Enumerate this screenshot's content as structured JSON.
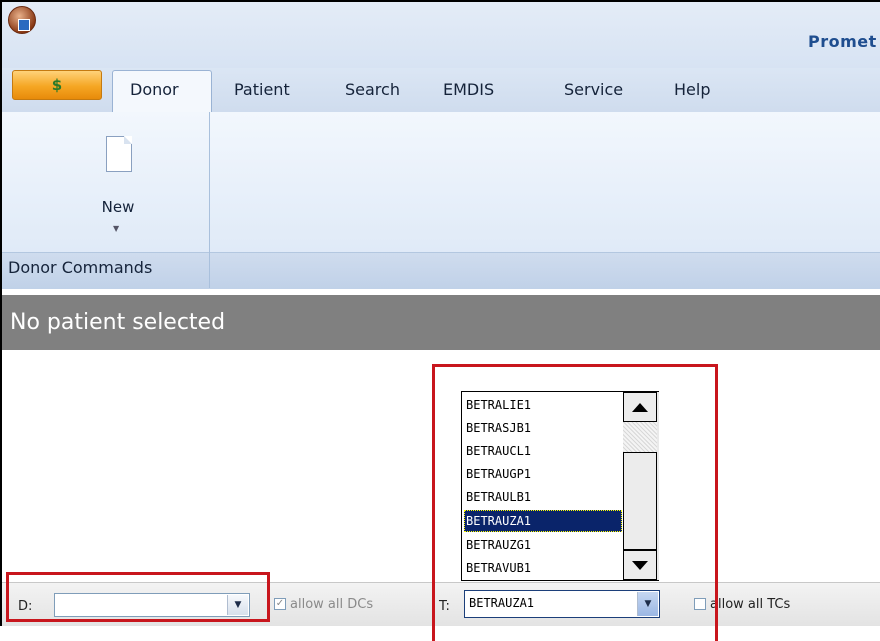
{
  "app": {
    "title": "Promet"
  },
  "tabs": [
    {
      "label": "Donor",
      "selected": true
    },
    {
      "label": "Patient"
    },
    {
      "label": "Search"
    },
    {
      "label": "EMDIS"
    },
    {
      "label": "Service"
    },
    {
      "label": "Help"
    }
  ],
  "home_button": {
    "icon": "dollar-icon",
    "glyph": "$"
  },
  "ribbon": {
    "new_label": "New",
    "new_icon": "new-document-icon",
    "group_label": "Donor Commands"
  },
  "status": {
    "text": "No patient selected"
  },
  "bottom": {
    "d_label": "D:",
    "d_value": "",
    "allow_dcs_label": "allow all DCs",
    "allow_dcs_checked": true,
    "t_label": "T:",
    "t_value": "BETRAUZA1",
    "allow_tcs_label": "allow all TCs",
    "allow_tcs_checked": false
  },
  "dropdown": {
    "options": [
      "BETRALIE1",
      "BETRASJB1",
      "BETRAUCL1",
      "BETRAUGP1",
      "BETRAULB1",
      "BETRAUZA1",
      "BETRAUZG1",
      "BETRAVUB1"
    ],
    "selected": "BETRAUZA1"
  },
  "colors": {
    "highlight": "#c8161d",
    "status_band": "#808080",
    "title_blue": "#1f4e8f",
    "selection": "#0a246a"
  }
}
